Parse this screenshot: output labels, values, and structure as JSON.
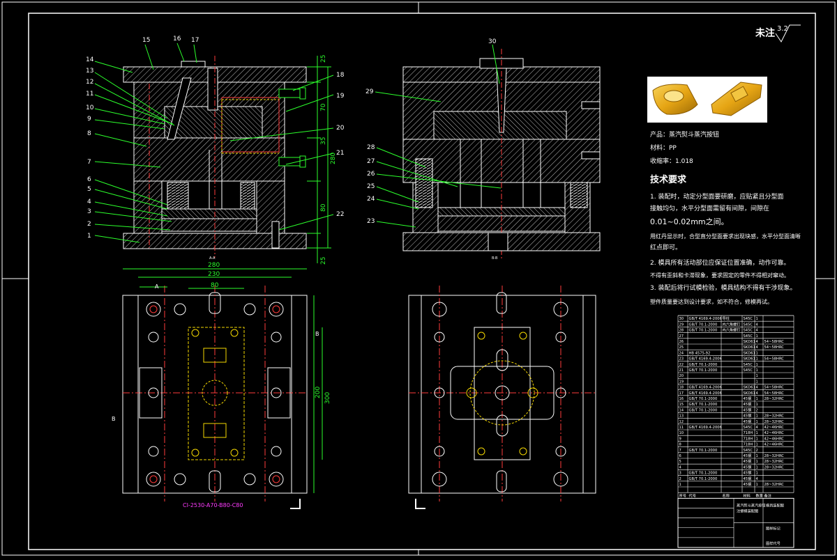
{
  "roughness": {
    "label": "未注",
    "value": "3.2"
  },
  "section_views": {
    "left": {
      "label": "A-A"
    },
    "right": {
      "label": "B-B"
    }
  },
  "balloons_left": [
    "15",
    "16",
    "17",
    "14",
    "13",
    "12",
    "11",
    "10",
    "9",
    "8",
    "7",
    "6",
    "5",
    "4",
    "3",
    "2",
    "1",
    "18",
    "19",
    "20",
    "21",
    "22"
  ],
  "balloons_right": [
    "30",
    "29",
    "28",
    "27",
    "26",
    "25",
    "24",
    "23"
  ],
  "dims_vertical_right": [
    "25",
    "70",
    "35",
    "280",
    "80",
    "25"
  ],
  "dims_plan": {
    "w280": "280",
    "w230": "230",
    "w80": "80",
    "h200": "200",
    "h300": "300",
    "sec_a": "A",
    "sec_b": "B"
  },
  "mold_base_code": "CI-2530-A70-B80-C80",
  "product_info": {
    "product": "产品：蒸汽熨斗蒸汽按钮",
    "material": "材料：PP",
    "shrinkage": "收缩率：1.018"
  },
  "tech_req": {
    "title": "技术要求",
    "lines": [
      "1. 装配时，动定分型面要研磨，应贴紧且分型面",
      "接触均匀，水平分型面需留有间隙，间隙在",
      "0.01~0.02mm之间。",
      "用红丹显示时，合型直分型面要求出现块感，水平分型面清晰",
      "红点即可。",
      "2. 模具所有活动部位应保证位置准确，动作可靠。",
      "不得有歪斜和卡滞现象，要求固定的零件不得相对窜动。",
      "3. 装配后将行试模检验，模具结构不得有干涉现象。",
      "塑件质量要达到设计要求，如不符合，修模再试。"
    ]
  },
  "bom": {
    "rows": [
      [
        "30",
        "GB/T 4169.4-2006",
        "导柱",
        "S45C",
        "1",
        ""
      ],
      [
        "29",
        "GB/T 70.1-2000",
        "内六角螺钉",
        "S45C",
        "4",
        ""
      ],
      [
        "28",
        "GB/T 70.1-2000",
        "内六角螺钉",
        "S45C",
        "4",
        ""
      ],
      [
        "27",
        "",
        "",
        "S45C",
        "1",
        ""
      ],
      [
        "26",
        "",
        "",
        "SKD61",
        "4",
        "54~58HRC"
      ],
      [
        "25",
        "",
        "",
        "SKD61",
        "4",
        "54~58HRC"
      ],
      [
        "24",
        "HB 4575-92",
        "",
        "SKD61",
        "1",
        ""
      ],
      [
        "23",
        "GB/T 4169.4-2006",
        "",
        "SKD61",
        "1",
        "54~58HRC"
      ],
      [
        "22",
        "GB/T 70.1-2000",
        "",
        "S45C",
        "1",
        ""
      ],
      [
        "21",
        "GB/T 70.1-2000",
        "",
        "S45C",
        "1",
        ""
      ],
      [
        "20",
        "",
        "",
        "",
        "1",
        ""
      ],
      [
        "19",
        "",
        "",
        "",
        "1",
        ""
      ],
      [
        "18",
        "GB/T 4169.4-2006",
        "",
        "SKD61",
        "4",
        "54~58HRC"
      ],
      [
        "17",
        "GB/T 4169.4-2006",
        "",
        "SKD61",
        "4",
        "54~58HRC"
      ],
      [
        "16",
        "GB/T 70.1-2000",
        "",
        "45钢",
        "1",
        "28~32HRC"
      ],
      [
        "15",
        "GB/T 70.1-2000",
        "",
        "45钢",
        "1",
        ""
      ],
      [
        "14",
        "GB/T 70.1-2000",
        "",
        "45钢",
        "2",
        ""
      ],
      [
        "13",
        "",
        "",
        "45钢",
        "1",
        "28~32HRC"
      ],
      [
        "12",
        "",
        "",
        "45钢",
        "1",
        "28~32HRC"
      ],
      [
        "11",
        "GB/T 4169.4-2006",
        "",
        "S45C",
        "4",
        "42~46HRC"
      ],
      [
        "10",
        "",
        "",
        "718H",
        "1",
        "42~46HRC"
      ],
      [
        "9",
        "",
        "",
        "718H",
        "1",
        "42~46HRC"
      ],
      [
        "8",
        "",
        "",
        "718H",
        "1",
        "42~46HRC"
      ],
      [
        "7",
        "GB/T 70.1-2000",
        "",
        "S45C",
        "2",
        ""
      ],
      [
        "6",
        "",
        "",
        "45钢",
        "1",
        "28~32HRC"
      ],
      [
        "5",
        "",
        "",
        "45钢",
        "1",
        "28~32HRC"
      ],
      [
        "4",
        "",
        "",
        "45钢",
        "1",
        "28~32HRC"
      ],
      [
        "3",
        "GB/T 70.1-2000",
        "",
        "45钢",
        "1",
        ""
      ],
      [
        "2",
        "GB/T 70.1-2000",
        "",
        "45钢",
        "4",
        ""
      ],
      [
        "1",
        "",
        "",
        "45钢",
        "1",
        "28~32HRC"
      ]
    ],
    "header": [
      "序号",
      "代号",
      "名称",
      "材料",
      "数量",
      "备注"
    ],
    "title_block": {
      "drawing_name": "蒸汽熨斗蒸汽按钮",
      "sub": "注塑模装配图",
      "org": "模具装配图",
      "scale": "图样标记",
      "code": "图样代号"
    }
  }
}
